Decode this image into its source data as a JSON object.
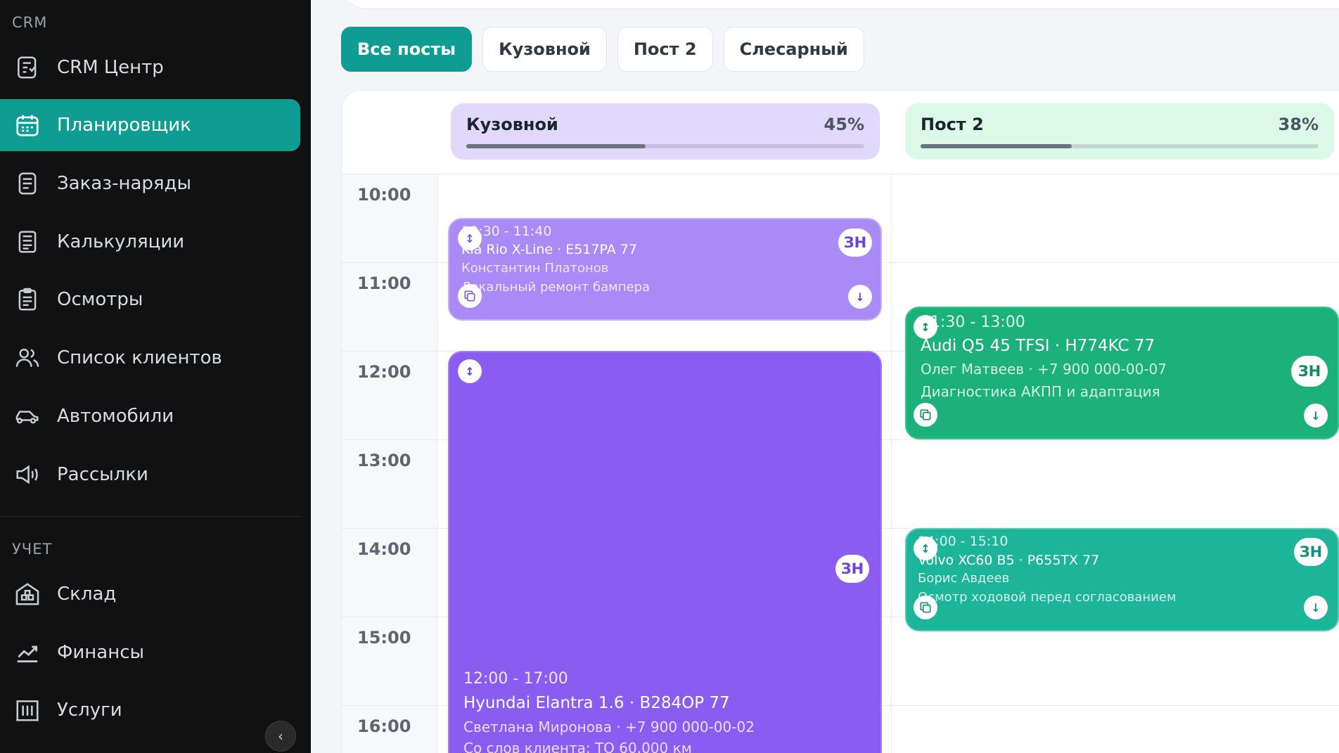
{
  "sidebar": {
    "section_crm": "CRM",
    "section_uchet": "УЧЕТ",
    "items": [
      {
        "label": "CRM Центр",
        "icon": "crm-center-icon"
      },
      {
        "label": "Планировщик",
        "icon": "calendar-icon",
        "active": true
      },
      {
        "label": "Заказ-наряды",
        "icon": "work-order-icon"
      },
      {
        "label": "Калькуляции",
        "icon": "calculation-icon"
      },
      {
        "label": "Осмотры",
        "icon": "clipboard-icon"
      },
      {
        "label": "Список клиентов",
        "icon": "users-icon"
      },
      {
        "label": "Автомобили",
        "icon": "car-icon"
      },
      {
        "label": "Рассылки",
        "icon": "megaphone-icon"
      }
    ],
    "items2": [
      {
        "label": "Склад",
        "icon": "warehouse-icon"
      },
      {
        "label": "Финансы",
        "icon": "finance-chart-icon"
      },
      {
        "label": "Услуги",
        "icon": "services-icon"
      }
    ],
    "collapse_glyph": "‹"
  },
  "filters": [
    "Все посты",
    "Кузовной",
    "Пост 2",
    "Слесарный"
  ],
  "active_filter": "Все посты",
  "posts": [
    {
      "name": "Кузовной",
      "load": "45%",
      "load_fraction": 0.45,
      "color": "#e0d9fb"
    },
    {
      "name": "Пост 2",
      "load": "38%",
      "load_fraction": 0.38,
      "color": "#dcf8e6"
    }
  ],
  "times": [
    "10:00",
    "11:00",
    "12:00",
    "13:00",
    "14:00",
    "15:00",
    "16:00"
  ],
  "events": [
    {
      "time": "10:30 - 11:40",
      "car": "Kia Rio X-Line · E517PA 77",
      "client": "Константин Платонов",
      "desc": "Локальный ремонт бампера",
      "badge": "ЗН",
      "color": "#a98af6"
    },
    {
      "time": "12:00 - 17:00",
      "car": "Hyundai Elantra 1.6 · B284OP 77",
      "client": "Светлана Миронова · +7 900 000-00-02",
      "desc": "Со слов клиента: ТО 60.000 км",
      "badge": "ЗН",
      "color": "#8b5cf0"
    },
    {
      "time": "11:30 - 13:00",
      "car": "Audi Q5 45 TFSI · H774KC 77",
      "client": "Олег Матвеев · +7 900 000-00-07",
      "desc": "Диагностика АКПП и адаптация",
      "badge": "ЗН",
      "color": "#1cb07a"
    },
    {
      "time": "14:00 - 15:10",
      "car": "Volvo XC60 B5 · P655TX 77",
      "client": "Борис Авдеев",
      "desc": "Осмотр ходовой перед согласованием",
      "badge": "ЗН",
      "color": "#1db59a"
    }
  ],
  "icons": {
    "move": "↕",
    "copy": "copy-icon",
    "down": "↓"
  }
}
